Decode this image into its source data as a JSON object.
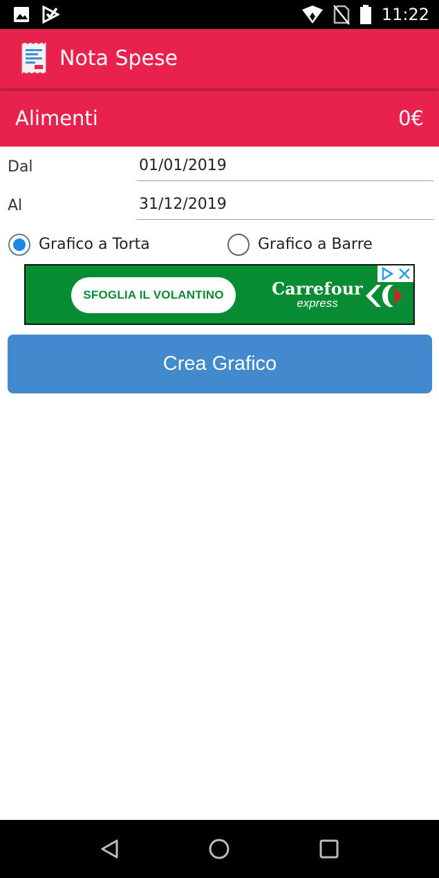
{
  "status_bar": {
    "time": "11:22",
    "left_icons": [
      "image-icon",
      "play-store-icon"
    ],
    "right_icons": [
      "wifi-icon",
      "no-sim-icon",
      "battery-icon"
    ]
  },
  "app_bar": {
    "title": "Nota Spese",
    "icon": "receipt-icon"
  },
  "category": {
    "name": "Alimenti",
    "amount": "0€"
  },
  "form": {
    "from_label": "Dal",
    "from_value": "01/01/2019",
    "to_label": "Al",
    "to_value": "31/12/2019"
  },
  "chart_type": {
    "options": [
      {
        "label": "Grafico a Torta",
        "checked": true
      },
      {
        "label": "Grafico a Barre",
        "checked": false
      }
    ]
  },
  "ad": {
    "cta": "SFOGLIA IL VOLANTINO",
    "brand": "Carrefour",
    "brand_sub": "express"
  },
  "actions": {
    "create_label": "Crea Grafico"
  },
  "nav_bar": {
    "icons": [
      "back-icon",
      "home-icon",
      "recents-icon"
    ]
  },
  "colors": {
    "primary": "#e8224d",
    "button": "#4389cd",
    "radio_checked": "#1e88e5",
    "ad_background": "#078c34"
  }
}
